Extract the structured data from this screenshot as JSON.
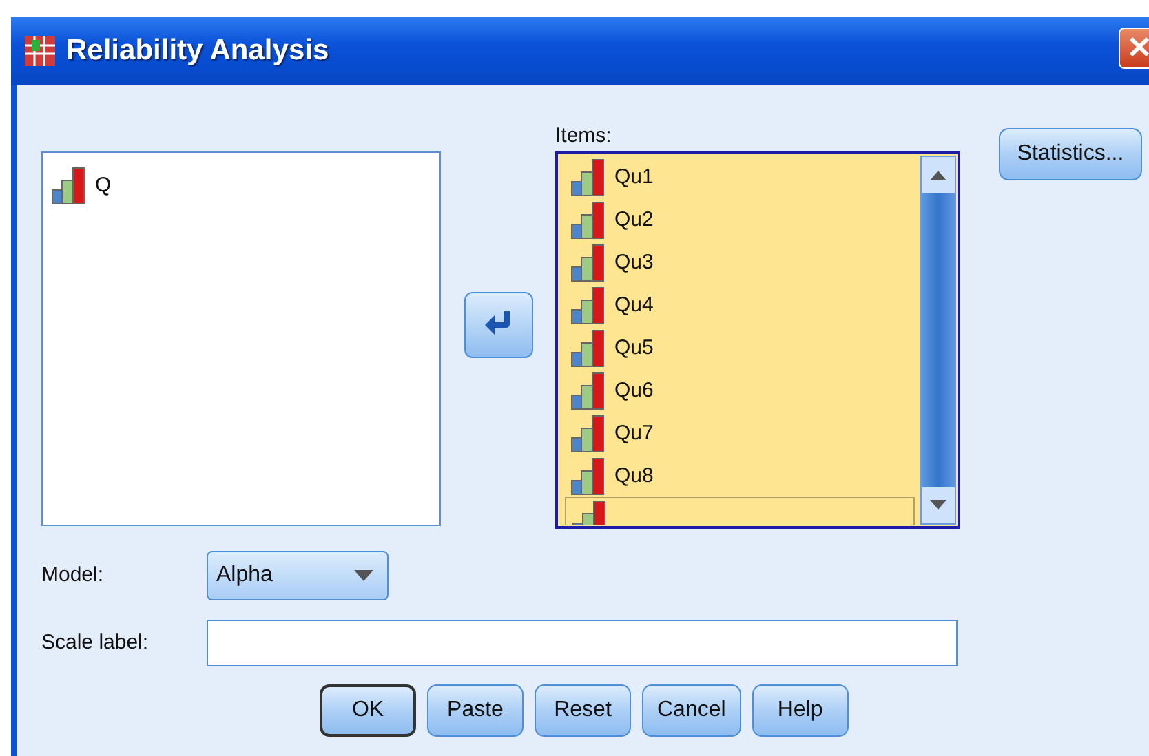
{
  "window": {
    "title": "Reliability Analysis"
  },
  "source_list": {
    "items": [
      {
        "label": "Q"
      }
    ]
  },
  "items_list": {
    "label": "Items:",
    "items": [
      {
        "label": "Qu1",
        "focused": false
      },
      {
        "label": "Qu2",
        "focused": false
      },
      {
        "label": "Qu3",
        "focused": false
      },
      {
        "label": "Qu4",
        "focused": false
      },
      {
        "label": "Qu5",
        "focused": false
      },
      {
        "label": "Qu6",
        "focused": false
      },
      {
        "label": "Qu7",
        "focused": false
      },
      {
        "label": "Qu8",
        "focused": false
      },
      {
        "focused": true
      }
    ]
  },
  "side_buttons": [
    "Statistics..."
  ],
  "model": {
    "label": "Model:",
    "value": "Alpha"
  },
  "scale_label": {
    "label": "Scale label:"
  },
  "buttons": [
    {
      "label": "OK",
      "default": true
    },
    {
      "label": "Paste",
      "default": false
    },
    {
      "label": "Reset",
      "default": false
    },
    {
      "label": "Cancel",
      "default": false
    },
    {
      "label": "Help",
      "default": false
    }
  ]
}
